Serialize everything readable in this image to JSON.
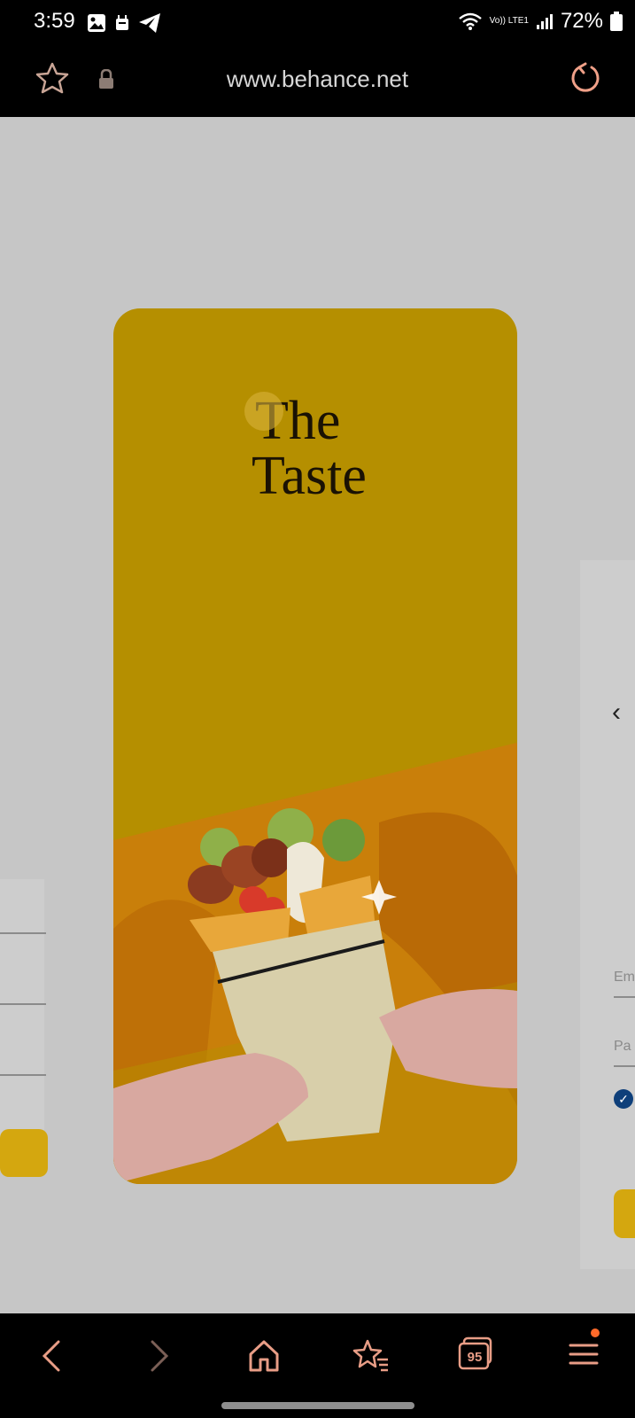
{
  "status": {
    "time": "3:59",
    "signal_label": "Vo)) LTE1",
    "battery": "72%"
  },
  "browser": {
    "url": "www.behance.net"
  },
  "card": {
    "title_line1": "The",
    "title_line2": "Taste"
  },
  "side_panel_right": {
    "email_label": "Em",
    "password_label": "Pa"
  },
  "nav": {
    "tabs_count": "95"
  },
  "colors": {
    "card_yellow": "#b58f00",
    "card_orange": "#c97f0a",
    "background": "#c6c6c6",
    "accent": "#ff7a3c"
  }
}
